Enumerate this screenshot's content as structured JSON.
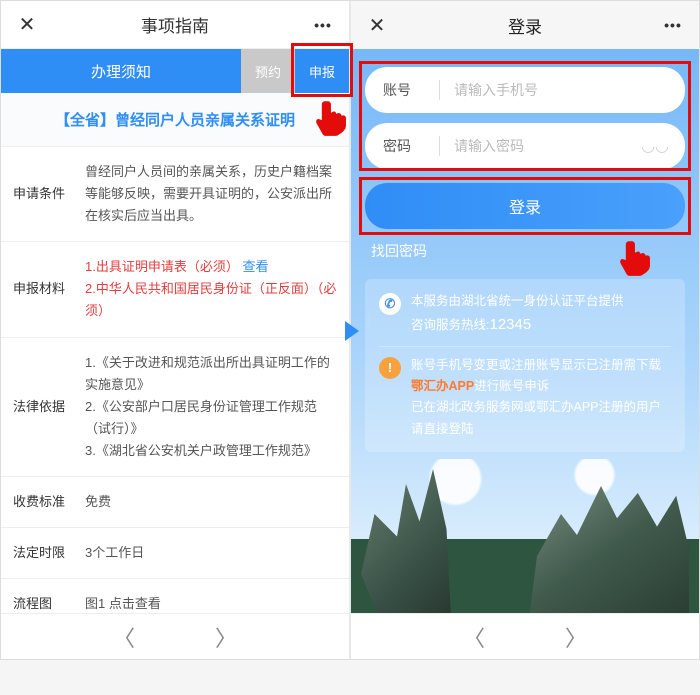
{
  "left": {
    "header_title": "事项指南",
    "tab_main": "办理须知",
    "tab_sub1": "预约",
    "tab_sub2": "申报",
    "banner": "【全省】曾经同户人员亲属关系证明",
    "rows": {
      "r1_label": "申请条件",
      "r1_body": "曾经同户人员间的亲属关系，历史户籍档案等能够反映，需要开具证明的，公安派出所在核实后应当出具。",
      "r2_label": "申报材料",
      "r2_l1": "1.出具证明申请表（必须）",
      "r2_l1_link": "查看",
      "r2_l2": "2.中华人民共和国居民身份证（正反面）（必须）",
      "r3_label": "法律依据",
      "r3_l1": "1.《关于改进和规范派出所出具证明工作的实施意见》",
      "r3_l2": "2.《公安部户口居民身份证管理工作规范（试行）》",
      "r3_l3": "3.《湖北省公安机关户政管理工作规范》",
      "r4_label": "收费标准",
      "r4_body": "免费",
      "r5_label": "法定时限",
      "r5_body": "3个工作日",
      "r6_label": "流程图",
      "r6_body": "图1 点击查看"
    }
  },
  "right": {
    "header_title": "登录",
    "acc_label": "账号",
    "acc_ph": "请输入手机号",
    "pwd_label": "密码",
    "pwd_ph": "请输入密码",
    "login_btn": "登录",
    "forgot": "找回密码",
    "info1a": "本服务由湖北省统一身份认证平台提供",
    "info1b_pre": "咨询服务热线:",
    "info1b_num": "12345",
    "info2a_pre": "账号手机号变更或注册账号显示已注册需下载",
    "info2a_app": "鄂汇办APP",
    "info2a_post": "进行账号申诉",
    "info2b": "已在湖北政务服务网或鄂汇办APP注册的用户请直接登陆"
  }
}
